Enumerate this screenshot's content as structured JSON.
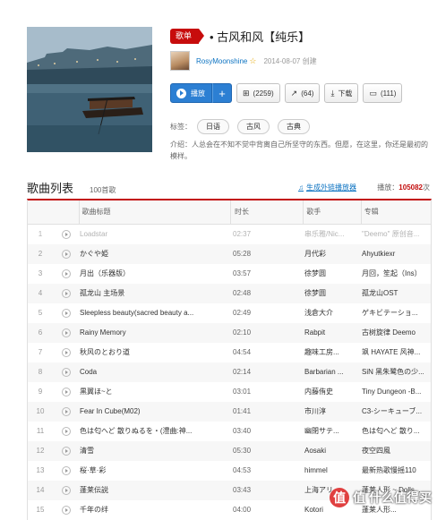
{
  "playlist": {
    "badge": "歌单",
    "title": "• 古风和风【纯乐】",
    "creator": "RosyMoonshine",
    "created": "2014-08-07 创建",
    "actions": {
      "play": "播放",
      "add": "+",
      "collect": "(2259)",
      "share": "(64)",
      "download": "下载",
      "comment": "(111)"
    },
    "tags_label": "标签：",
    "tags": [
      "日语",
      "古风",
      "古典"
    ],
    "intro": "介绍：人总会在不知不觉中背离自己所坚守的东西。但愿，在这里，你还是最初的模样。"
  },
  "songlist": {
    "title": "歌曲列表",
    "count": "100首歌",
    "outlink": "生成外链播放器",
    "plays_label": "播放：",
    "plays": "105082",
    "plays_unit": "次",
    "headers": {
      "title": "歌曲标题",
      "duration": "时长",
      "artist": "歌手",
      "album": "专辑"
    },
    "rows": [
      {
        "idx": "1",
        "title": "Loadstar",
        "dur": "02:37",
        "artist": "串乐雅/Nic...",
        "album": "\"Deemo\" 原创音...",
        "dim": true
      },
      {
        "idx": "2",
        "title": "かぐや姫",
        "dur": "05:28",
        "artist": "月代彩",
        "album": "Ahyutkiexr"
      },
      {
        "idx": "3",
        "title": "月出（乐器版）",
        "dur": "03:57",
        "artist": "徐梦圆",
        "album": "月回，笙起（Ins）"
      },
      {
        "idx": "4",
        "title": "孤龙山 主场景",
        "dur": "02:48",
        "artist": "徐梦圆",
        "album": "孤龙山OST"
      },
      {
        "idx": "5",
        "title": "Sleepless beauty(sacred beauty a...",
        "dur": "02:49",
        "artist": "浅倉大介",
        "album": "ゲキビテーショ..."
      },
      {
        "idx": "6",
        "title": "Rainy Memory",
        "dur": "02:10",
        "artist": "Rabpit",
        "album": "古树旋律 Deemo"
      },
      {
        "idx": "7",
        "title": "秋风のとおり道",
        "dur": "04:54",
        "artist": "趣味工房...",
        "album": "飒 HAYATE 风神..."
      },
      {
        "idx": "8",
        "title": "Coda",
        "dur": "02:14",
        "artist": "Barbarian ...",
        "album": "SiN 黑朱鹭色の少..."
      },
      {
        "idx": "9",
        "title": "黒翼ほ~と",
        "dur": "03:01",
        "artist": "内藤侑史",
        "album": "Tiny Dungeon -B..."
      },
      {
        "idx": "10",
        "title": "Fear In Cube(M02)",
        "dur": "01:41",
        "artist": "市川淳",
        "album": "C3-シーキューブ..."
      },
      {
        "idx": "11",
        "title": "色は匂へど 散りぬるを・(澧曲:神...",
        "dur": "03:40",
        "artist": "幽閉サテ...",
        "album": "色は匂へど 散り..."
      },
      {
        "idx": "12",
        "title": "清雪",
        "dur": "05:30",
        "artist": "Aosaki",
        "album": "夜空四風"
      },
      {
        "idx": "13",
        "title": "桜·草·彩",
        "dur": "04:53",
        "artist": "himmel",
        "album": "最新热歌慢摇110"
      },
      {
        "idx": "14",
        "title": "蓬莱伝説",
        "dur": "03:43",
        "artist": "上海アリ...",
        "album": "蓬莱人形 ~ Dolls..."
      },
      {
        "idx": "15",
        "title": "千年の绊",
        "dur": "04:00",
        "artist": "Kotori",
        "album": "蓬莱人形..."
      }
    ]
  },
  "watermark": "值 什么值得买",
  "colors": {
    "accent": "#c20c0c",
    "link": "#0c73c2",
    "play_button": "#2c7fd3"
  }
}
